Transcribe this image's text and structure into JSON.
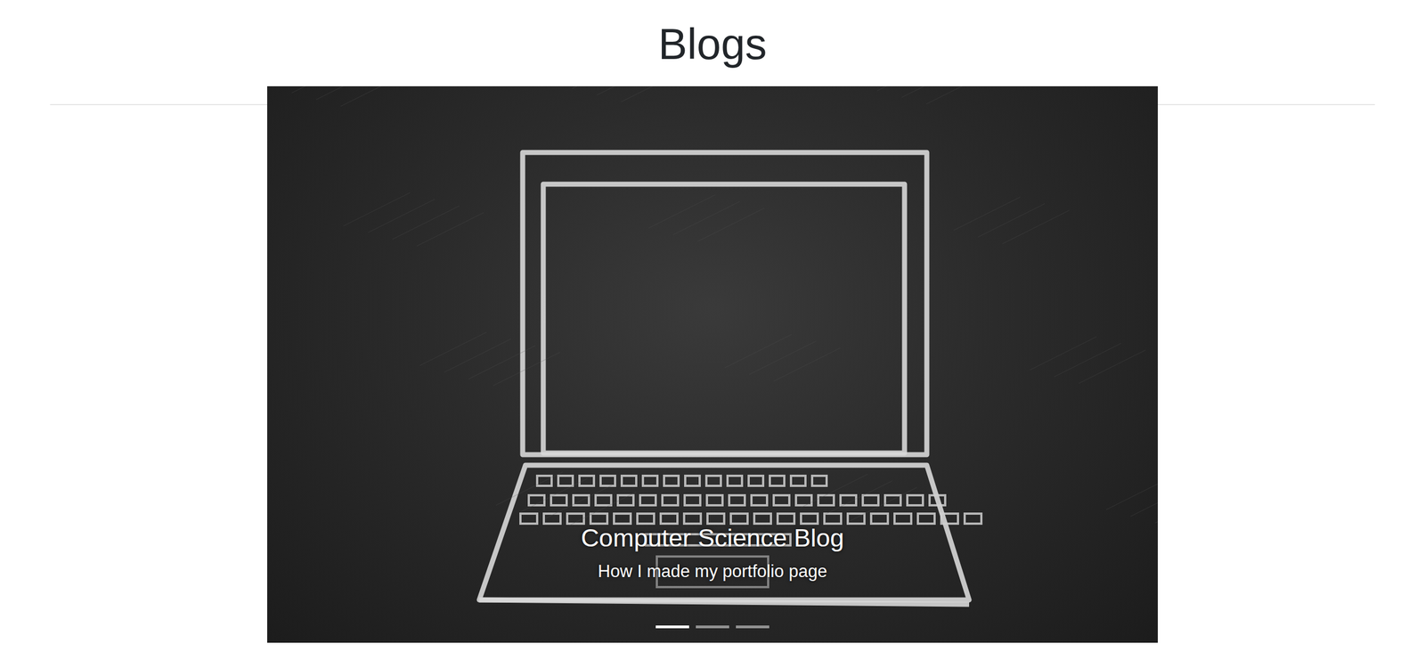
{
  "heading": "Blogs",
  "carousel": {
    "slide": {
      "title": "Computer Science Blog",
      "caption": "How I made my portfolio page"
    },
    "indicators": [
      {
        "selected": true
      },
      {
        "selected": false
      },
      {
        "selected": false
      }
    ]
  }
}
